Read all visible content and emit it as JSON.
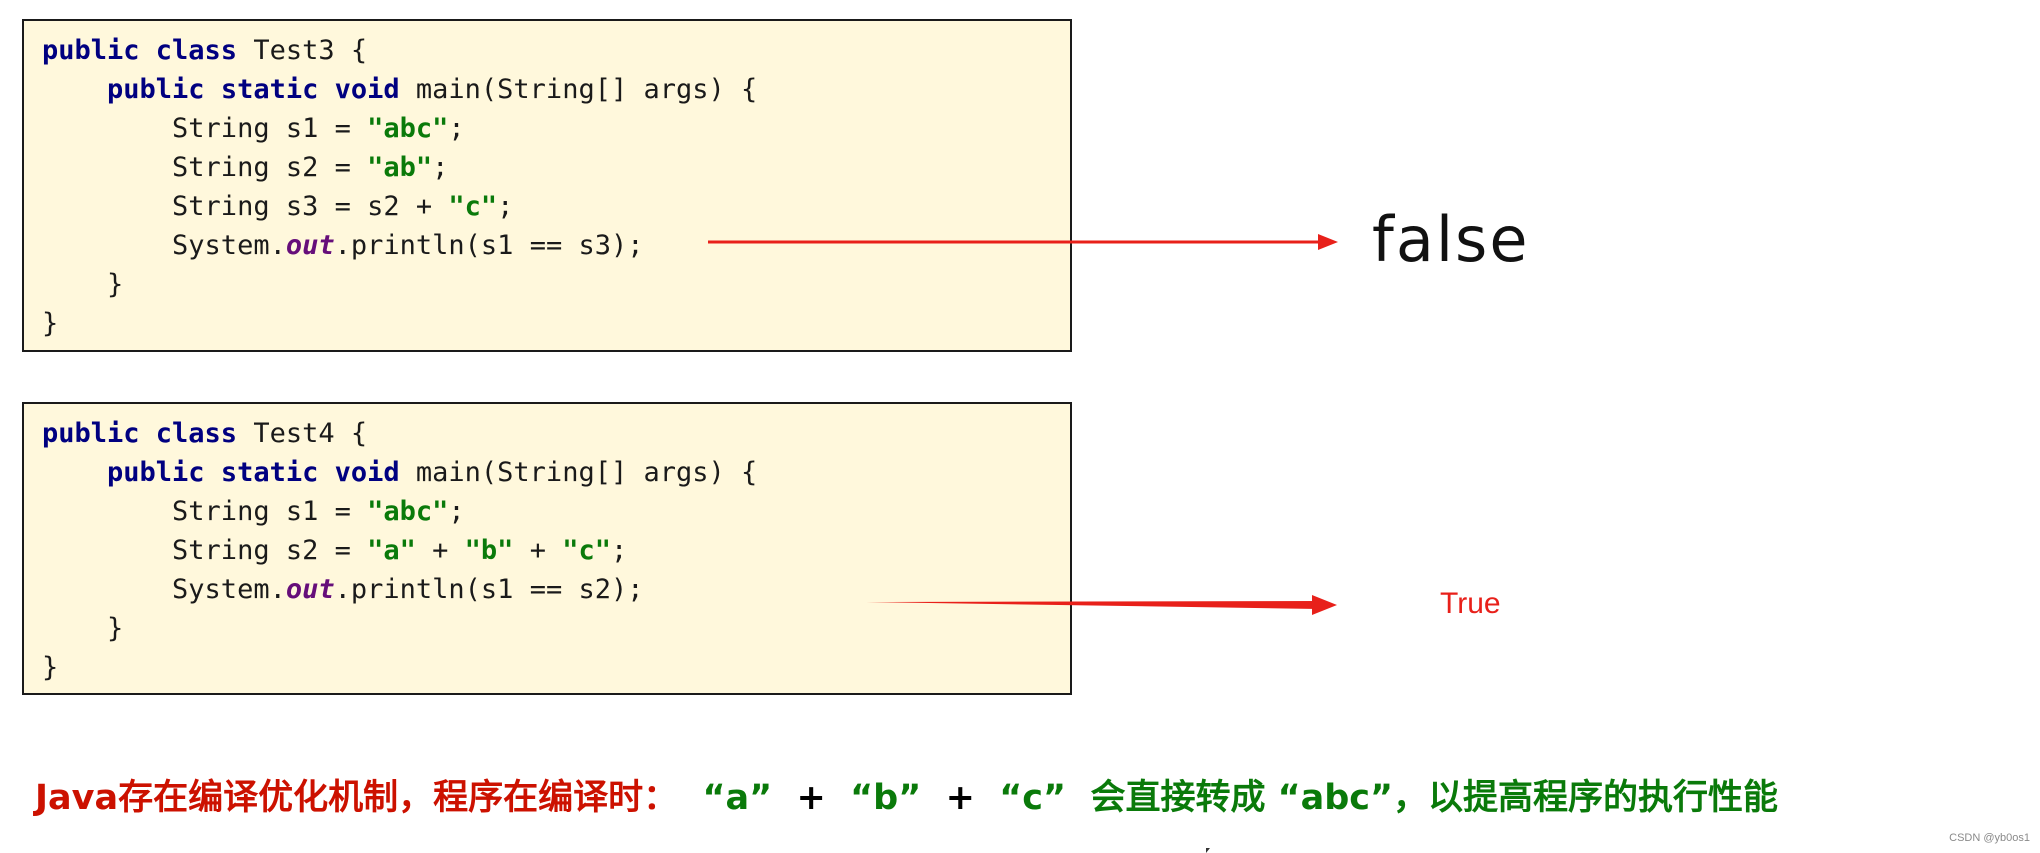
{
  "code_blocks": [
    {
      "class_name": "Test3",
      "lines": [
        [
          {
            "t": "public class ",
            "c": "kw"
          },
          {
            "t": "Test3 {",
            "c": ""
          }
        ],
        [
          {
            "t": "    ",
            "c": ""
          },
          {
            "t": "public static void ",
            "c": "kw"
          },
          {
            "t": "main(String[] args) {",
            "c": ""
          }
        ],
        [
          {
            "t": "        String s1 = ",
            "c": ""
          },
          {
            "t": "\"abc\"",
            "c": "str"
          },
          {
            "t": ";",
            "c": ""
          }
        ],
        [
          {
            "t": "        String s2 = ",
            "c": ""
          },
          {
            "t": "\"ab\"",
            "c": "str"
          },
          {
            "t": ";",
            "c": ""
          }
        ],
        [
          {
            "t": "        String s3 = s2 + ",
            "c": ""
          },
          {
            "t": "\"c\"",
            "c": "str"
          },
          {
            "t": ";",
            "c": ""
          }
        ],
        [
          {
            "t": "        System.",
            "c": ""
          },
          {
            "t": "out",
            "c": "fld"
          },
          {
            "t": ".println(s1 == s3);",
            "c": ""
          }
        ],
        [
          {
            "t": "    }",
            "c": ""
          }
        ],
        [
          {
            "t": "}",
            "c": ""
          }
        ]
      ],
      "result": "false"
    },
    {
      "class_name": "Test4",
      "lines": [
        [
          {
            "t": "public class ",
            "c": "kw"
          },
          {
            "t": "Test4 {",
            "c": ""
          }
        ],
        [
          {
            "t": "    ",
            "c": ""
          },
          {
            "t": "public static void ",
            "c": "kw"
          },
          {
            "t": "main(String[] args) {",
            "c": ""
          }
        ],
        [
          {
            "t": "        String s1 = ",
            "c": ""
          },
          {
            "t": "\"abc\"",
            "c": "str"
          },
          {
            "t": ";",
            "c": ""
          }
        ],
        [
          {
            "t": "        String s2 = ",
            "c": ""
          },
          {
            "t": "\"a\"",
            "c": "str"
          },
          {
            "t": " + ",
            "c": ""
          },
          {
            "t": "\"b\"",
            "c": "str"
          },
          {
            "t": " + ",
            "c": ""
          },
          {
            "t": "\"c\"",
            "c": "str"
          },
          {
            "t": ";",
            "c": ""
          }
        ],
        [
          {
            "t": "        System.",
            "c": ""
          },
          {
            "t": "out",
            "c": "fld"
          },
          {
            "t": ".println(s1 == s2);",
            "c": ""
          }
        ],
        [
          {
            "t": "    }",
            "c": ""
          }
        ],
        [
          {
            "t": "}",
            "c": ""
          }
        ]
      ],
      "result": "True"
    }
  ],
  "conclusion": {
    "red_part": "Java存在编译优化机制，程序在编译时：",
    "q_a": "“a”",
    "plus1": "+",
    "q_b": "“b”",
    "plus2": "+",
    "q_c": "“c”",
    "green_part": "会直接转成 “abc”，以提高程序的执行性能"
  },
  "colors": {
    "keyword": "#000080",
    "string": "#0a7a0a",
    "field": "#660e7a",
    "arrow": "#e8201a",
    "conclusion_red": "#cc1100",
    "conclusion_green": "#0a7a0a",
    "code_background": "#fff8dc"
  },
  "watermark": "CSDN @yb0os1"
}
